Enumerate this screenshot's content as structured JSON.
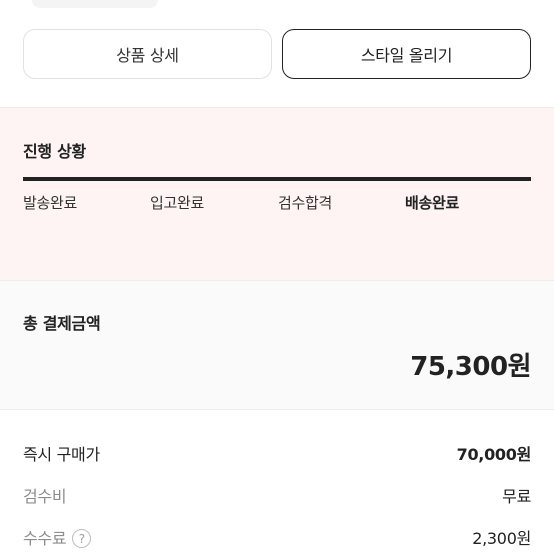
{
  "buttons": {
    "product_detail": "상품 상세",
    "upload_style": "스타일 올리기"
  },
  "progress": {
    "title": "진행 상황",
    "steps": [
      "발송완료",
      "입고완료",
      "검수합격",
      "배송완료"
    ],
    "active_step": "배송완료"
  },
  "payment": {
    "label": "총 결제금액",
    "total": "75,300원"
  },
  "breakdown": {
    "instant_price_label": "즉시 구매가",
    "instant_price_value": "70,000원",
    "inspection_label": "검수비",
    "inspection_value": "무료",
    "fee_label": "수수료",
    "fee_help_icon": "?",
    "fee_value": "2,300원"
  }
}
